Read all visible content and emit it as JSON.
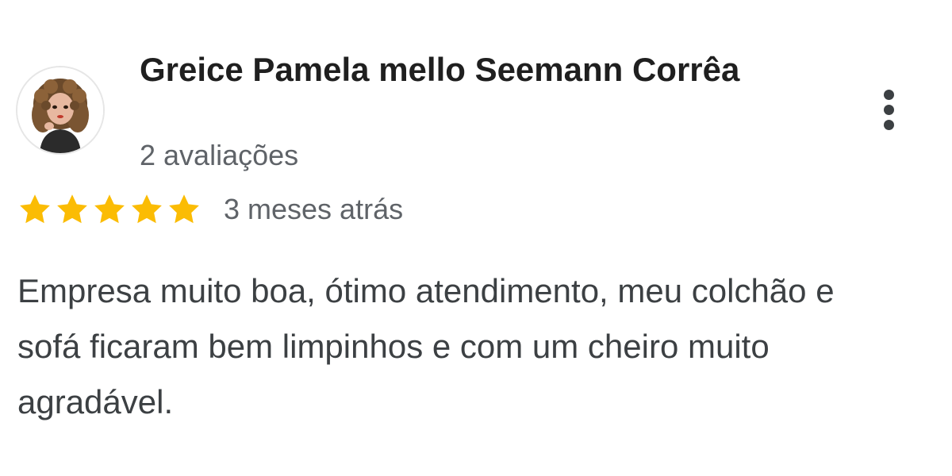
{
  "review": {
    "author_name": "Greice Pamela mello Seemann Corrêa",
    "author_review_count": "2 avaliações",
    "rating": 5,
    "rating_max": 5,
    "date": "3 meses atrás",
    "text": "Empresa muito boa, ótimo atendimento, meu colchão e sofá ficaram bem limpinhos e com um cheiro muito agradável."
  },
  "icons": {
    "more": "more-vert-icon",
    "star": "star-icon",
    "avatar": "user-avatar"
  },
  "colors": {
    "star": "#fbbc04",
    "name": "#1f1f1f",
    "secondary": "#5f6368",
    "body": "#3c4043"
  }
}
